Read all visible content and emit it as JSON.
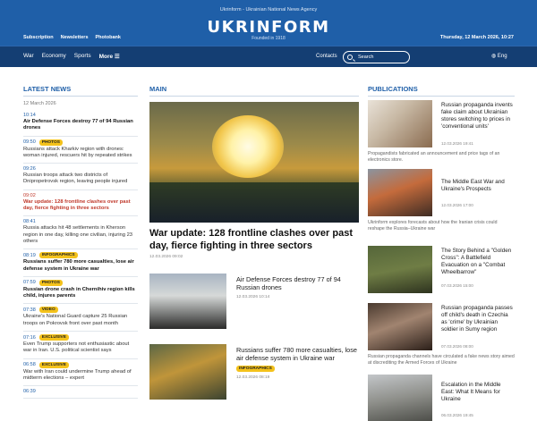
{
  "header": {
    "tagline": "Ukrinform - Ukrainian National News Agency",
    "logo": "UKRINFORM",
    "founded": "Founded in 1918",
    "top_links": [
      "Subscription",
      "Newsletters",
      "Photobank"
    ],
    "date": "Thursday, 12 March 2026, 10:27"
  },
  "nav": {
    "items": [
      "War",
      "Economy",
      "Sports"
    ],
    "more": "More ☰",
    "contacts": "Contacts",
    "search_placeholder": "Search",
    "language": "Eng"
  },
  "latest": {
    "title": "LATEST NEWS",
    "date": "12 March 2026",
    "items": [
      {
        "time": "10:14",
        "badge": "",
        "text": "Air Defense Forces destroy 77 of 94 Russian drones",
        "style": "bold"
      },
      {
        "time": "09:50",
        "badge": "PHOTOS",
        "text": "Russians attack Kharkiv region with drones: woman injured, rescuers hit by repeated strikes",
        "style": "normal"
      },
      {
        "time": "09:26",
        "badge": "",
        "text": "Russian troops attack two districts of Dnipropetrovsk region, leaving people injured",
        "style": "normal"
      },
      {
        "time": "09:02",
        "badge": "",
        "text": "War update: 128 frontline clashes over past day, fierce fighting in three sectors",
        "style": "red"
      },
      {
        "time": "08:41",
        "badge": "",
        "text": "Russia attacks hit 48 settlements in Kherson region in one day, killing one civilian, injuring 23 others",
        "style": "normal"
      },
      {
        "time": "08:19",
        "badge": "INFOGRAPHICS",
        "text": "Russians suffer 780 more casualties, lose air defense system in Ukraine war",
        "style": "bold"
      },
      {
        "time": "07:59",
        "badge": "PHOTOS",
        "text": "Russian drone crash in Chernihiv region kills child, injures parents",
        "style": "bold"
      },
      {
        "time": "07:38",
        "badge": "VIDEO",
        "text": "Ukraine's National Guard capture 25 Russian troops on Pokrovsk front over past month",
        "style": "normal"
      },
      {
        "time": "07:16",
        "badge": "EXCLUSIVE",
        "text": "Even Trump supporters not enthusiastic about war in Iran. U.S. political scientist says",
        "style": "normal"
      },
      {
        "time": "06:58",
        "badge": "EXCLUSIVE",
        "text": "War with Iran could undermine Trump ahead of midterm elections – expert",
        "style": "normal"
      },
      {
        "time": "06:39",
        "badge": "",
        "text": "",
        "style": "normal"
      }
    ]
  },
  "main": {
    "title": "MAIN",
    "hero_title": "War update: 128 frontline clashes over past day, fierce fighting in three sectors",
    "hero_date": "12.03.2026 09:02",
    "stories": [
      {
        "title": "Air Defense Forces destroy 77 of 94 Russian drones",
        "date": "12.03.2026 10:14",
        "badge": ""
      },
      {
        "title": "Russians suffer 780 more casualties, lose air defense system in Ukraine war",
        "date": "12.03.2026 08:19",
        "badge": "INFOGRAPHICS"
      }
    ]
  },
  "publications": {
    "title": "PUBLICATIONS",
    "items": [
      {
        "title": "Russian propaganda invents fake claim about Ukrainian stores switching to prices in 'conventional units'",
        "date": "12.03.2026 19:41",
        "desc": "Propagandists fabricated an announcement and price tags of an electronics store."
      },
      {
        "title": "The Middle East War and Ukraine's Prospects",
        "date": "12.03.2026 17:00",
        "desc": "Ukrinform explores forecasts about how the Iranian crisis could reshape the Russia–Ukraine war"
      },
      {
        "title": "The Story Behind a \"Golden Cross\": A Battlefield Evacuation on a \"Combat Wheelbarrow\"",
        "date": "07.03.2026 15:00",
        "desc": ""
      },
      {
        "title": "Russian propaganda passes off child's death in Czechia as 'crime' by Ukrainian soldier in Sumy region",
        "date": "07.03.2026 08:00",
        "desc": "Russian propaganda channels have circulated a fake news story aimed at discrediting the Armed Forces of Ukraine"
      },
      {
        "title": "Escalation in the Middle East: What It Means for Ukraine",
        "date": "06.03.2026 19:45",
        "desc": ""
      }
    ]
  }
}
